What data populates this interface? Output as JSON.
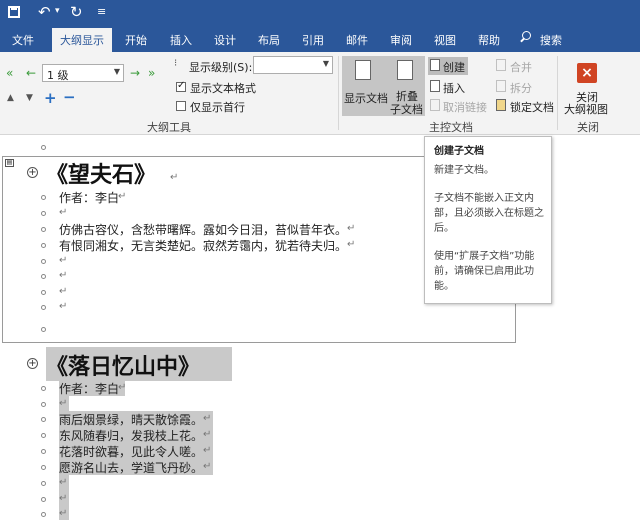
{
  "colors": {
    "brand": "#2b579a",
    "ribbon": "#f3f3f3",
    "selection": "#c9c9c9",
    "close_red": "#d04423"
  },
  "titlebar": {
    "save_icon": "save-icon",
    "undo_icon": "undo-icon",
    "redo_icon": "redo-icon",
    "dropdown_glyph": "▾",
    "customize_glyph": "≡"
  },
  "tabs": {
    "file": "文件",
    "outline": "大纲显示",
    "home": "开始",
    "insert": "插入",
    "design": "设计",
    "layout": "布局",
    "references": "引用",
    "mailings": "邮件",
    "review": "审阅",
    "view": "视图",
    "help": "帮助",
    "search": "搜索"
  },
  "ribbon": {
    "level_value": "1 级",
    "show_level_label": "显示级别(S):",
    "show_level_value": "",
    "show_text_format": "显示文本格式",
    "show_text_format_checked": true,
    "show_first_line": "仅显示首行",
    "show_first_line_checked": false,
    "outline_tools": "大纲工具",
    "show_document": "显示文档",
    "collapse_sub_1": "折叠",
    "collapse_sub_2": "子文档",
    "create": "创建",
    "insert": "插入",
    "unlink": "取消链接",
    "merge": "合并",
    "split": "拆分",
    "lock_document": "锁定文档",
    "master_document": "主控文档",
    "close_outline_1": "关闭",
    "close_outline_2": "大纲视图",
    "close_group": "关闭"
  },
  "tooltip": {
    "title": "创建子文档",
    "line1": "新建子文档。",
    "line2": "子文档不能嵌入正文内部，且必须嵌入在标题之后。",
    "line3": "使用“扩展子文档”功能前，请确保已启用此功能。"
  },
  "doc1": {
    "title": "《望夫石》",
    "author": "作者：李白",
    "line1": "仿佛古容仪，含愁带曙辉。露如今日泪，苔似昔年衣。",
    "line2": "有恨同湘女，无言类楚妃。寂然芳霭内，犹若待夫归。"
  },
  "doc2": {
    "title": "《落日忆山中》",
    "author": "作者：李白",
    "line1": "雨后烟景绿，晴天散馀霞。",
    "line2": "东风随春归，发我枝上花。",
    "line3": "花落时欲暮，见此令人嗟。",
    "line4": "愿游名山去，学道飞丹砂。"
  },
  "return_mark": "↵"
}
